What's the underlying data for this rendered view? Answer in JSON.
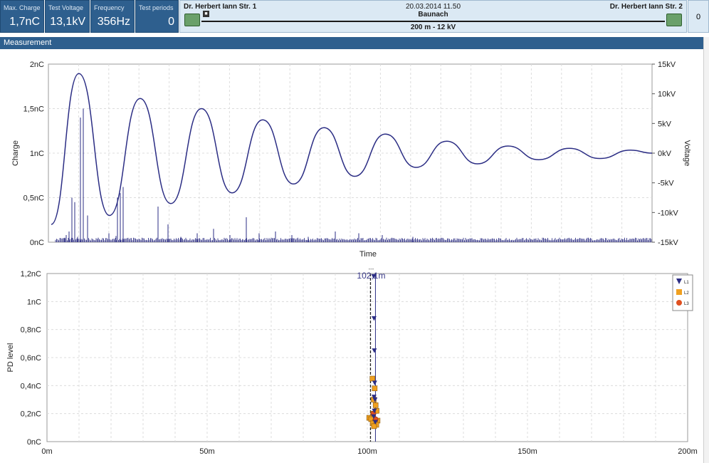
{
  "header": {
    "max_charge": {
      "label": "Max. Charge",
      "value": "1,7nC"
    },
    "test_voltage": {
      "label": "Test Voltage",
      "value": "13,1kV"
    },
    "frequency": {
      "label": "Frequency",
      "value": "356Hz"
    },
    "test_periods": {
      "label": "Test periods",
      "value": "0"
    },
    "route": {
      "left_station": "Dr. Herbert Iann Str. 1",
      "right_station": "Dr. Herbert Iann Str. 2",
      "datetime": "20.03.2014 11.50",
      "location": "Baunach",
      "cable": "200 m - 12 kV"
    },
    "count": "0"
  },
  "panel": {
    "title": "Measurement"
  },
  "colors": {
    "accent": "#2e5f8e",
    "trace": "#2b2d84",
    "l2": "#f0a020",
    "l3": "#e05020"
  },
  "chart_data": [
    {
      "type": "line",
      "title": "",
      "xlabel": "Time",
      "ylabel": "Charge",
      "ylabel_right": "Voltage",
      "ylim": [
        0,
        2
      ],
      "ylim_right": [
        -15,
        15
      ],
      "yticks": [
        "0nC",
        "0,5nC",
        "1nC",
        "1,5nC",
        "2nC"
      ],
      "yticks_right": [
        "-15kV",
        "-10kV",
        "-5kV",
        "0kV",
        "5kV",
        "10kV",
        "15kV"
      ],
      "series": [
        {
          "name": "",
          "axis": "right",
          "peaks_kV": [
            13.4,
            -10.5,
            9.2,
            -8.5,
            7.5,
            -6.7,
            5.6,
            -5.2,
            4.3,
            -3.9,
            3.2,
            -2.4,
            2.0,
            -1.8,
            1.2,
            -1.1,
            0.8,
            -0.9,
            0.5
          ]
        }
      ],
      "pd_spikes_nC": [
        0.05,
        0.08,
        0.12,
        0.5,
        0.45,
        0.06,
        1.4,
        1.5,
        0.3,
        0.05,
        0.1,
        0.07,
        0.5,
        0.55,
        0.62,
        0.4,
        0.2,
        0.06,
        0.1,
        0.15,
        0.08,
        0.28,
        0.1,
        0.12,
        0.08,
        0.06,
        0.12,
        0.1,
        0.08,
        0.06
      ]
    },
    {
      "type": "scatter",
      "title": "",
      "xlabel": "",
      "ylabel": "PD level",
      "xlim": [
        0,
        200
      ],
      "ylim": [
        0,
        1.2
      ],
      "xticks": [
        "0m",
        "50m",
        "100m",
        "150m",
        "200m"
      ],
      "yticks": [
        "0nC",
        "0,2nC",
        "0,4nC",
        "0,6nC",
        "0,8nC",
        "1nC",
        "1,2nC"
      ],
      "marker_label": "102,1m",
      "marker_top": "---",
      "marker_x": 102.1,
      "legend": [
        "L1",
        "L2",
        "L3"
      ],
      "series": [
        {
          "name": "L1",
          "x": [
            102.0,
            102.1,
            102.2,
            102.3,
            102.1,
            102.4,
            102.2,
            102.0,
            102.5
          ],
          "y": [
            1.18,
            0.88,
            0.65,
            0.42,
            0.32,
            0.3,
            0.22,
            0.18,
            0.14
          ]
        },
        {
          "name": "L2",
          "x": [
            101.6,
            102.3,
            102.0,
            102.6,
            102.9,
            101.8,
            100.6,
            101.2,
            103.2,
            102.4,
            101.7,
            102.8,
            102.1
          ],
          "y": [
            0.45,
            0.38,
            0.3,
            0.26,
            0.22,
            0.2,
            0.17,
            0.16,
            0.15,
            0.14,
            0.13,
            0.12,
            0.11
          ]
        },
        {
          "name": "L3",
          "x": [
            101.9,
            102.6
          ],
          "y": [
            0.2,
            0.16
          ]
        }
      ]
    }
  ]
}
